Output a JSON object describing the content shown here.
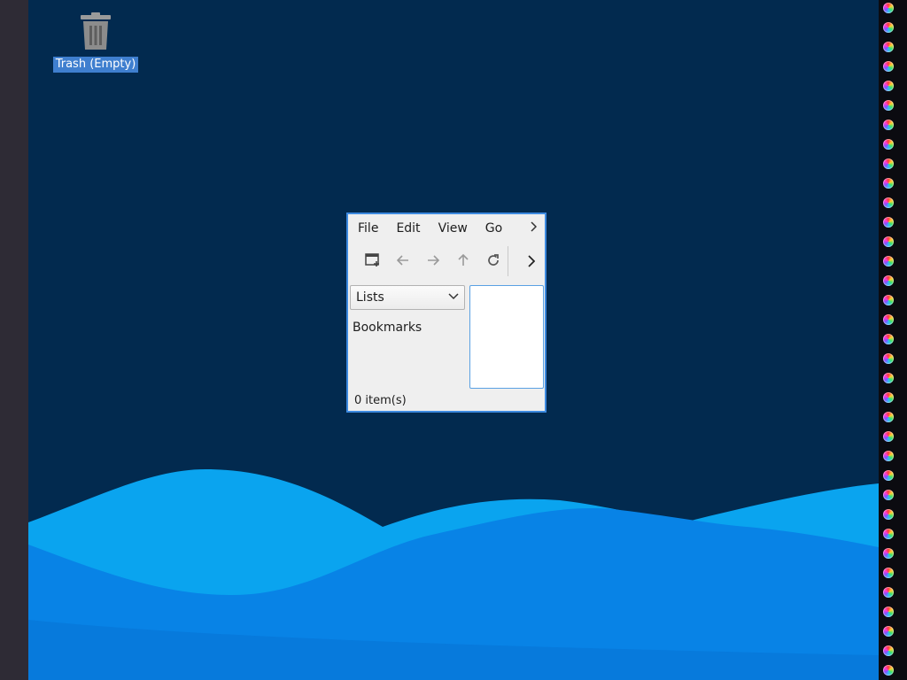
{
  "desktop": {
    "icons": [
      {
        "label": "Trash (Empty)",
        "icon": "trash-icon"
      }
    ],
    "wallpaper_colors": {
      "background": "#022a4f",
      "wave_light": "#0aa4ef",
      "wave_mid": "#0883e6",
      "wave_dark": "#066fd1"
    }
  },
  "window": {
    "menubar": {
      "file": "File",
      "edit": "Edit",
      "view": "View",
      "go": "Go",
      "more_icon": "chevron-right-icon"
    },
    "toolbar": {
      "buttons": [
        "new-tab-icon",
        "back-icon",
        "forward-icon",
        "up-icon",
        "reload-icon"
      ],
      "more_icon": "chevron-right-icon"
    },
    "side_panel": {
      "selected": "Lists",
      "dropdown_icon": "chevron-down-icon",
      "section": "Bookmarks"
    },
    "statusbar": {
      "text": "0 item(s)"
    },
    "accent": "#3d8ae0"
  }
}
